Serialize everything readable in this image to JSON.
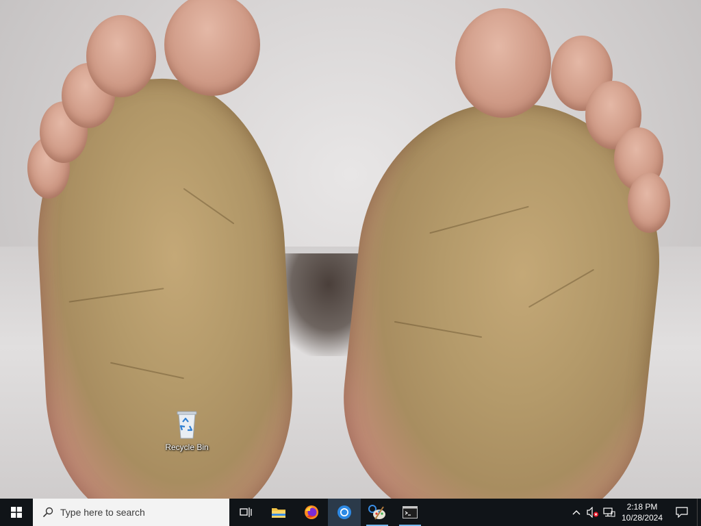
{
  "desktop": {
    "icons": [
      {
        "label": "Recycle Bin",
        "icon": "recycle-bin-icon"
      }
    ]
  },
  "taskbar": {
    "start_icon": "windows-logo-icon",
    "search": {
      "placeholder": "Type here to search",
      "icon": "search-icon"
    },
    "pinned": [
      {
        "name": "Task View",
        "icon": "task-view-icon"
      },
      {
        "name": "File Explorer",
        "icon": "folder-icon"
      },
      {
        "name": "Firefox",
        "icon": "firefox-icon"
      },
      {
        "name": "Chrome",
        "icon": "chrome-icon",
        "active": true
      },
      {
        "name": "Paint",
        "icon": "paint-icon",
        "running": true
      },
      {
        "name": "Command Prompt",
        "icon": "terminal-icon",
        "running": true
      }
    ],
    "tray": {
      "icons": [
        "chevron-up-icon",
        "volume-muted-icon",
        "network-icon"
      ],
      "time": "2:18 PM",
      "date": "10/28/2024",
      "notification_icon": "notification-icon"
    }
  },
  "colors": {
    "taskbar_bg": "#101418",
    "search_bg": "#f3f3f3",
    "accent": "#76b9ed"
  }
}
